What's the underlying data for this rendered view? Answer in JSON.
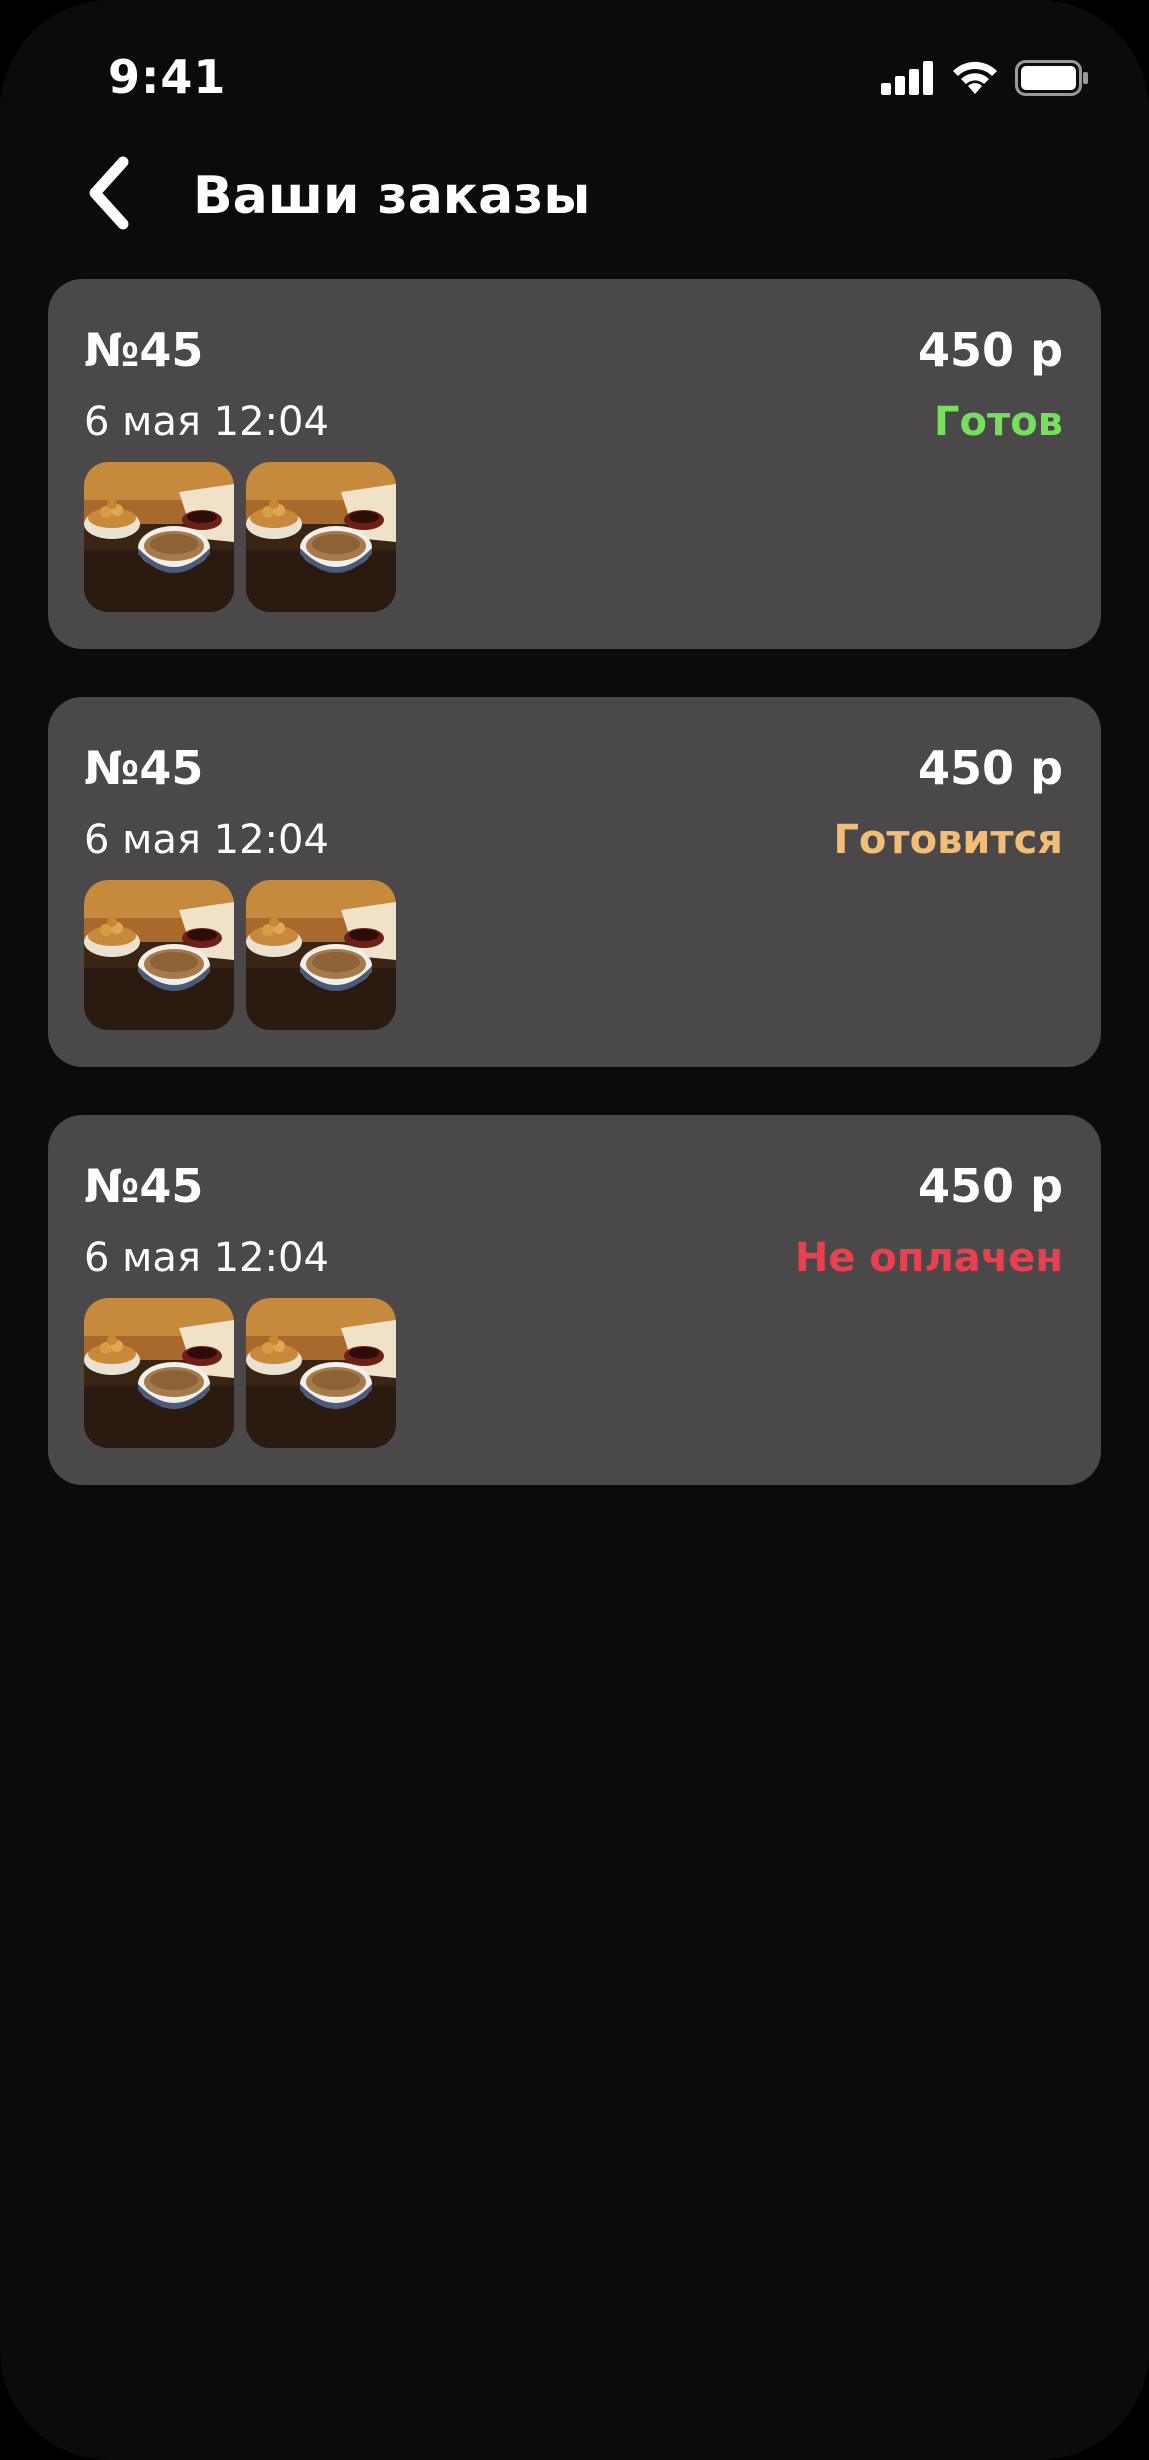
{
  "status_bar": {
    "time": "9:41"
  },
  "header": {
    "title": "Ваши заказы",
    "back_icon": "chevron-left-icon"
  },
  "colors": {
    "background": "#0b0b0b",
    "card": "#4a4848",
    "status_ready": "#76e05c",
    "status_cooking": "#f2bd78",
    "status_unpaid": "#e8404f"
  },
  "orders": [
    {
      "number": "№45",
      "price": "450 р",
      "date": "6 мая 12:04",
      "status": "Готов",
      "status_color": "#76e05c",
      "items": [
        "food-photo",
        "food-photo"
      ]
    },
    {
      "number": "№45",
      "price": "450 р",
      "date": "6 мая 12:04",
      "status": "Готовится",
      "status_color": "#f2bd78",
      "items": [
        "food-photo",
        "food-photo"
      ]
    },
    {
      "number": "№45",
      "price": "450 р",
      "date": "6 мая 12:04",
      "status": "Не оплачен",
      "status_color": "#e8404f",
      "items": [
        "food-photo",
        "food-photo"
      ]
    }
  ]
}
